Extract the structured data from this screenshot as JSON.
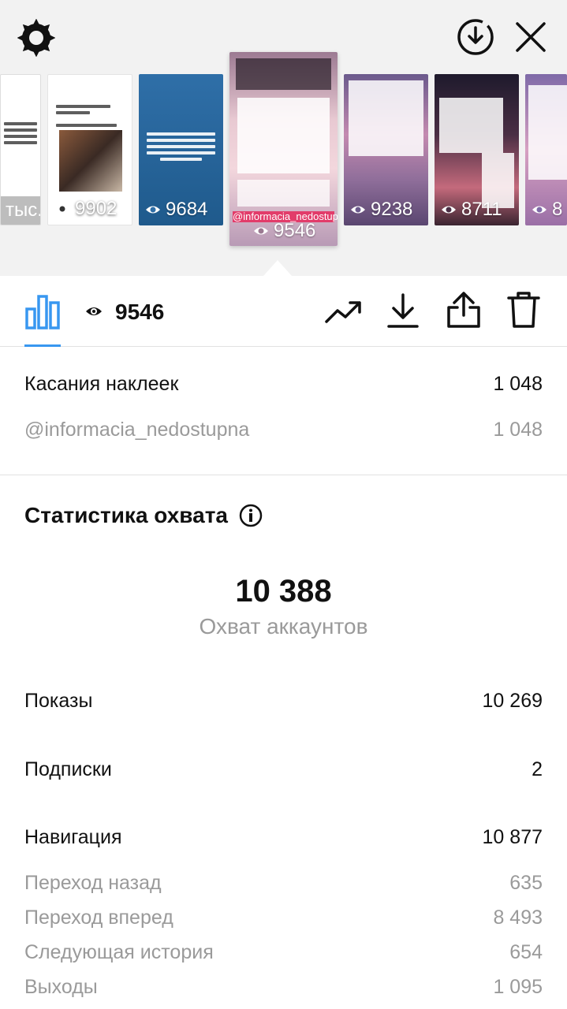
{
  "carousel": {
    "thumbs": [
      {
        "views": "тыс."
      },
      {
        "views": "9902"
      },
      {
        "views": "9684"
      },
      {
        "views": "9546",
        "handle": "@informacia_nedostupna"
      },
      {
        "views": "9238"
      },
      {
        "views": "8711"
      },
      {
        "views": "8"
      }
    ]
  },
  "toolbar": {
    "views": "9546"
  },
  "stickers": {
    "label": "Касания наклеек",
    "value": "1 048",
    "sub_label": "@informacia_nedostupna",
    "sub_value": "1 048"
  },
  "reach": {
    "title": "Статистика охвата",
    "number": "10 388",
    "number_label": "Охват аккаунтов",
    "rows": [
      {
        "label": "Показы",
        "value": "10 269"
      },
      {
        "label": "Подписки",
        "value": "2"
      },
      {
        "label": "Навигация",
        "value": "10 877"
      }
    ],
    "nav_rows": [
      {
        "label": "Переход назад",
        "value": "635"
      },
      {
        "label": "Переход вперед",
        "value": "8 493"
      },
      {
        "label": "Следующая история",
        "value": "654"
      },
      {
        "label": "Выходы",
        "value": "1 095"
      }
    ]
  },
  "colors": {
    "accent": "#3897f0",
    "muted": "#9a9a9a"
  }
}
